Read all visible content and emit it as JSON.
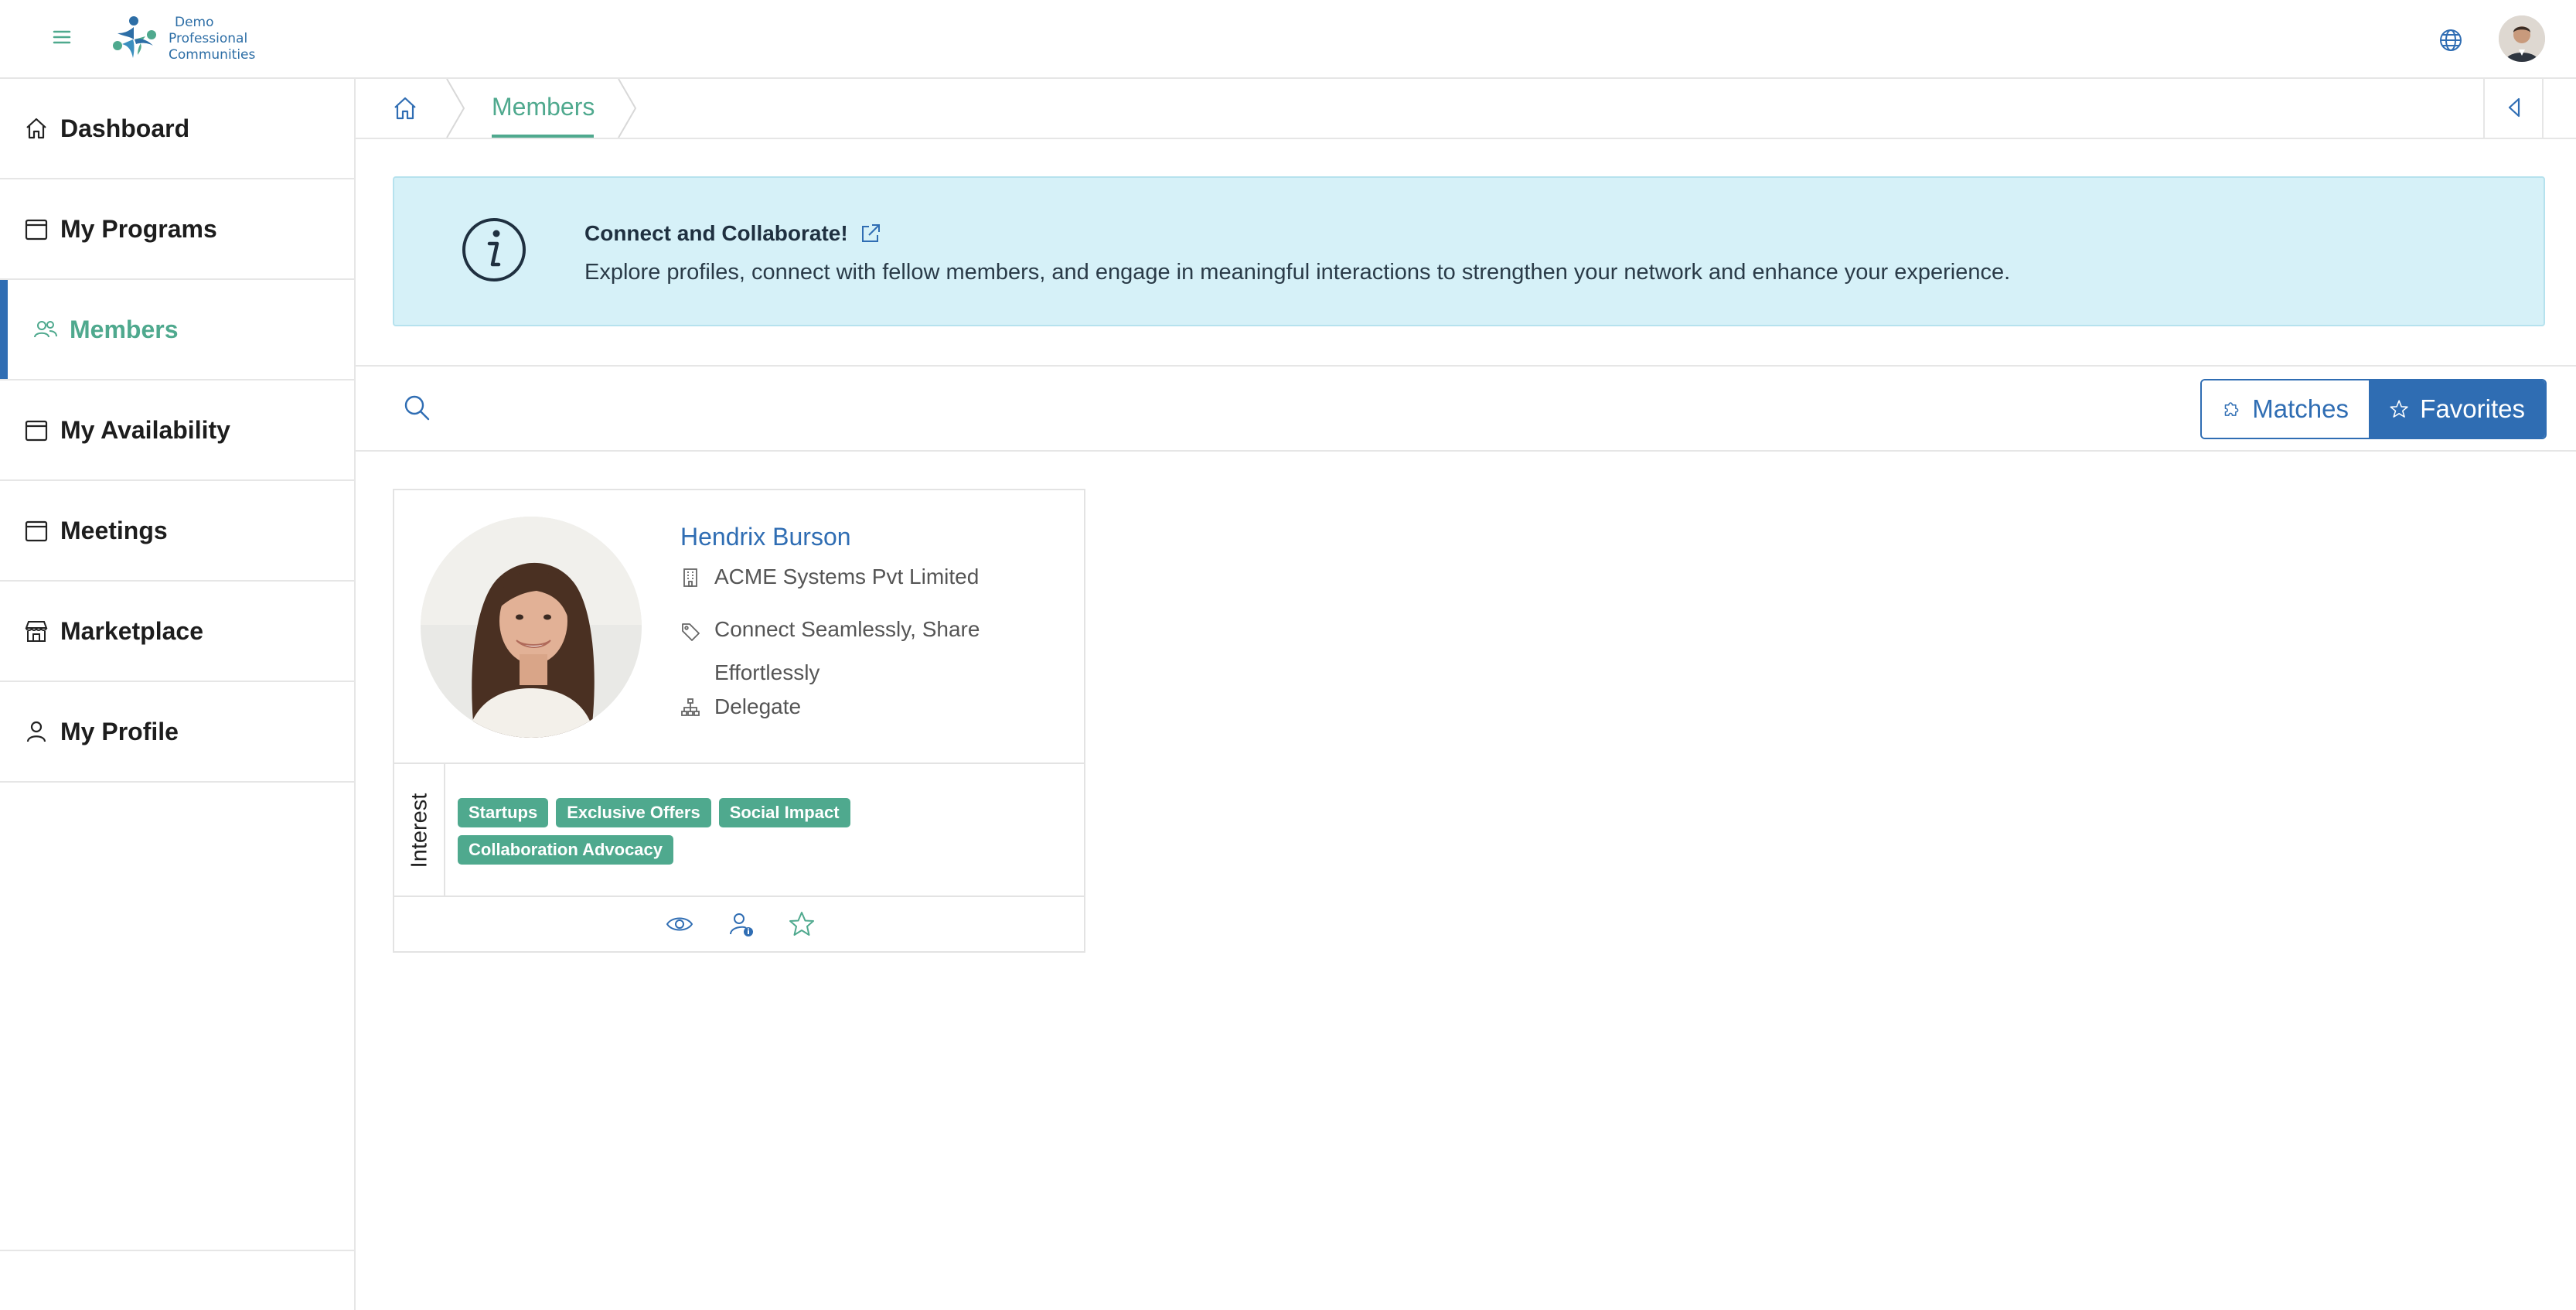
{
  "app": {
    "logo_line1": "Demo",
    "logo_line2": "Professional",
    "logo_line3": "Communities",
    "colors": {
      "primary": "#2f6db3",
      "accent": "#4fa98e",
      "banner_bg": "#d6f1f8"
    }
  },
  "header": {
    "menu_icon": "hamburger-icon",
    "language_icon": "globe-icon",
    "user_avatar": "avatar"
  },
  "sidebar": {
    "items": [
      {
        "label": "Dashboard",
        "icon": "home-icon",
        "active": false
      },
      {
        "label": "My Programs",
        "icon": "calendar-icon",
        "active": false
      },
      {
        "label": "Members",
        "icon": "users-icon",
        "active": true
      },
      {
        "label": "My Availability",
        "icon": "calendar-icon",
        "active": false
      },
      {
        "label": "Meetings",
        "icon": "calendar-icon",
        "active": false
      },
      {
        "label": "Marketplace",
        "icon": "store-icon",
        "active": false
      },
      {
        "label": "My Profile",
        "icon": "user-icon",
        "active": false
      }
    ]
  },
  "breadcrumb": {
    "home_icon": "home-icon",
    "current": "Members",
    "collapse_icon": "caret-left-icon"
  },
  "banner": {
    "title": "Connect and Collaborate!",
    "description": "Explore profiles, connect with fellow members, and engage in meaningful interactions to strengthen your network and enhance your experience.",
    "icon": "info-icon",
    "link_icon": "external-link-icon"
  },
  "toolbar": {
    "search_icon": "search-icon",
    "matches_label": "Matches",
    "favorites_label": "Favorites"
  },
  "members": [
    {
      "name": "Hendrix Burson",
      "organization": "ACME Systems Pvt Limited",
      "tagline": "Connect Seamlessly, Share Effortlessly",
      "role": "Delegate",
      "interest_heading": "Interest",
      "interests": [
        "Startups",
        "Exclusive Offers",
        "Social Impact",
        "Collaboration Advocacy"
      ],
      "actions": [
        "view-icon",
        "user-info-icon",
        "star-icon"
      ]
    }
  ]
}
